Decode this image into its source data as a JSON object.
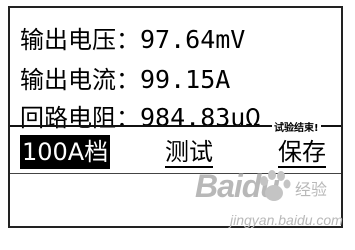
{
  "readings": [
    {
      "label": "输出电压：",
      "value": "97.64mV"
    },
    {
      "label": "输出电流：",
      "value": "99.15A"
    },
    {
      "label": "回路电阻：",
      "value": "984.83uΩ"
    }
  ],
  "status_text": "试验结束!",
  "menu": [
    {
      "label": "100A档",
      "selected": true
    },
    {
      "label": "测试",
      "selected": false
    },
    {
      "label": "保存",
      "selected": false
    }
  ],
  "watermark": {
    "logo": "Baidu",
    "cn": "经验",
    "url": "jingyan.baidu.com"
  }
}
